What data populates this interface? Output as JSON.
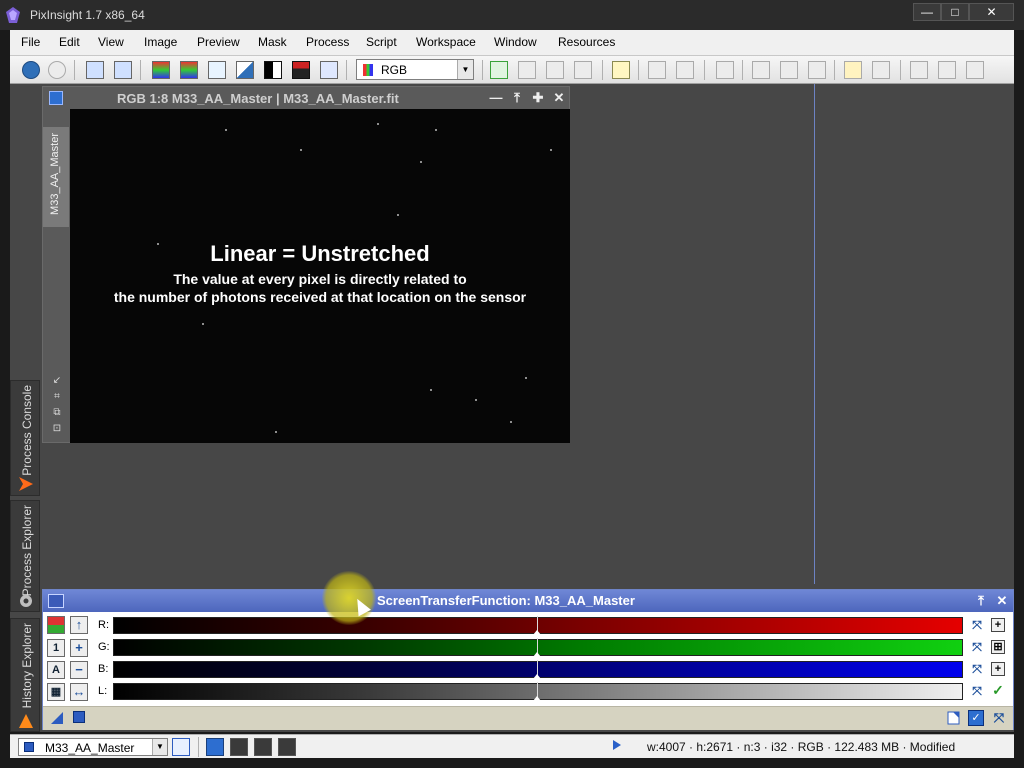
{
  "window": {
    "title": "PixInsight 1.7 x86_64",
    "controls": {
      "minimize": "—",
      "maximize": "□",
      "close": "✕"
    }
  },
  "menubar": {
    "items": [
      "File",
      "Edit",
      "View",
      "Image",
      "Preview",
      "Mask",
      "Process",
      "Script",
      "Workspace",
      "Window",
      "Resources"
    ]
  },
  "toolbar": {
    "channel_select": {
      "value": "RGB"
    }
  },
  "side_tabs": {
    "process_console": "Process Console",
    "process_explorer": "Process Explorer",
    "history_explorer": "History Explorer"
  },
  "image_window": {
    "title": "RGB 1:8 M33_AA_Master | M33_AA_Master.fit",
    "view_tab": "M33_AA_Master",
    "controls": {
      "shade": "—",
      "top": "⤒",
      "maximize": "✚",
      "close": "✕"
    },
    "overlay": {
      "heading": "Linear = Unstretched",
      "line1": "The value at every pixel is directly related to",
      "line2": "the number of photons received at that location on the sensor"
    }
  },
  "stf": {
    "title": "ScreenTransferFunction: M33_AA_Master",
    "channels": [
      {
        "label": "R:",
        "color": "#e50000",
        "left_btn": "■",
        "right_btn": "+"
      },
      {
        "label": "G:",
        "color": "#10d010",
        "left_btn": "1",
        "right_btn": "⊞"
      },
      {
        "label": "B:",
        "color": "#0000ee",
        "left_btn": "A",
        "right_btn": "+"
      },
      {
        "label": "L:",
        "color": "#f0f0f0",
        "left_btn": "▦",
        "right_btn": "✓"
      }
    ],
    "second_btns": [
      "↑",
      "+",
      "−",
      "↔"
    ]
  },
  "statusbar": {
    "view": "M33_AA_Master",
    "info": "w:4007 · h:2671 · n:3 · i32 · RGB · 122.483 MB · Modified"
  },
  "colors": {
    "workspace_bg": "#474747",
    "stf_title": "#5a72c8",
    "accent_blue": "#2d6ed0"
  }
}
